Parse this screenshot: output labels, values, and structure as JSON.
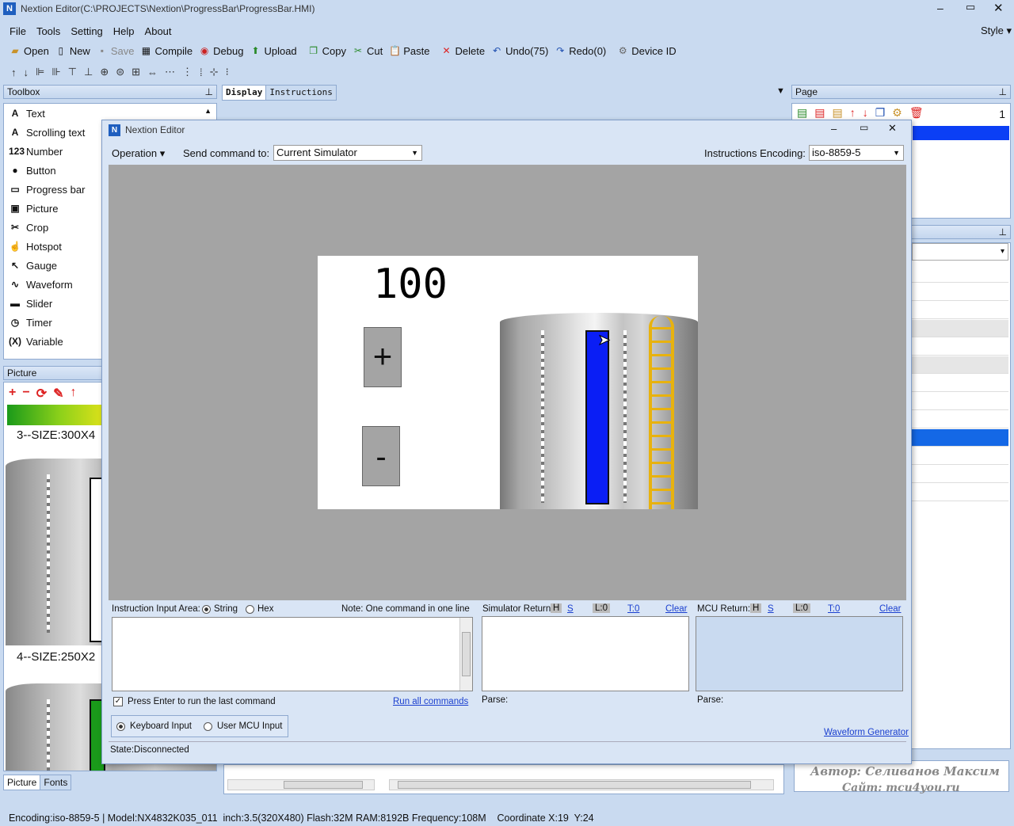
{
  "app": {
    "title": "Nextion Editor(C:\\PROJECTS\\Nextion\\ProgressBar\\ProgressBar.HMI)",
    "style_menu": "Style"
  },
  "menu": [
    "File",
    "Tools",
    "Setting",
    "Help",
    "About"
  ],
  "toolbar": {
    "open": "Open",
    "new": "New",
    "save": "Save",
    "compile": "Compile",
    "debug": "Debug",
    "upload": "Upload",
    "copy": "Copy",
    "cut": "Cut",
    "paste": "Paste",
    "delete": "Delete",
    "undo": "Undo(75)",
    "redo": "Redo(0)",
    "device_id": "Device ID"
  },
  "toolbox": {
    "title": "Toolbox",
    "items": [
      {
        "label": "Text",
        "icon": "A"
      },
      {
        "label": "Scrolling text",
        "icon": "A"
      },
      {
        "label": "Number",
        "icon": "123"
      },
      {
        "label": "Button",
        "icon": "●"
      },
      {
        "label": "Progress bar",
        "icon": "▭"
      },
      {
        "label": "Picture",
        "icon": "▣"
      },
      {
        "label": "Crop",
        "icon": "✂"
      },
      {
        "label": "Hotspot",
        "icon": "☝"
      },
      {
        "label": "Gauge",
        "icon": "↖"
      },
      {
        "label": "Waveform",
        "icon": "∿"
      },
      {
        "label": "Slider",
        "icon": "▬"
      },
      {
        "label": "Timer",
        "icon": "◷"
      },
      {
        "label": "Variable",
        "icon": "(X)"
      }
    ]
  },
  "picture_panel": {
    "title": "Picture",
    "item3": "3--SIZE:300X4",
    "item4": "4--SIZE:250X2",
    "tab_picture": "Picture",
    "tab_fonts": "Fonts"
  },
  "editor_tabs": {
    "display": "Display",
    "instructions": "Instructions"
  },
  "page_panel": {
    "title": "Page",
    "count": "1"
  },
  "dialog": {
    "title": "Nextion Editor",
    "operation": "Operation",
    "send_label": "Send command to:",
    "send_value": "Current Simulator",
    "enc_label": "Instructions Encoding:",
    "enc_value": "iso-8859-5",
    "sim": {
      "number": "100",
      "plus": "+",
      "minus": "-"
    },
    "input_area": {
      "label": "Instruction Input Area:",
      "string": "String",
      "hex": "Hex",
      "note": "Note: One command in one line",
      "press_enter": "Press Enter to run the last command",
      "run_all": "Run all commands",
      "keyboard": "Keyboard Input",
      "user_mcu": "User MCU Input"
    },
    "sim_return": {
      "label": "Simulator Return:",
      "h": "H",
      "s": "S",
      "l": "L:0",
      "t": "T:0",
      "clear": "Clear",
      "parse": "Parse:"
    },
    "mcu_return": {
      "label": "MCU Return:",
      "h": "H",
      "s": "S",
      "l": "L:0",
      "t": "T:0",
      "clear": "Clear",
      "parse": "Parse:"
    },
    "waveform": "Waveform Generator",
    "state": "State:Disconnected"
  },
  "watermark": {
    "author": "Автор: Селиванов Максим",
    "site": "Сайт: mcu4you.ru"
  },
  "statusbar": "Encoding:iso-8859-5 | Model:NX4832K035_011  inch:3.5(320X480) Flash:32M RAM:8192B Frequency:108M    Coordinate X:19  Y:24"
}
